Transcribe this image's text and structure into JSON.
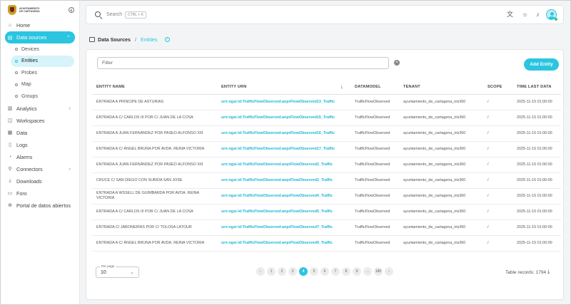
{
  "brand": {
    "line1": "AYUNTAMIENTO",
    "line2": "DE CARTAGENA"
  },
  "colors": {
    "accent": "#2cc5e0",
    "urn_text": "#1cb7d4"
  },
  "sidebar": {
    "items": [
      {
        "label": "Home",
        "icon": "home-icon"
      },
      {
        "label": "Data sources",
        "icon": "data-sources-icon",
        "active": true
      },
      {
        "label": "Analytics",
        "icon": "analytics-icon"
      },
      {
        "label": "Workspaces",
        "icon": "workspaces-icon"
      },
      {
        "label": "Data",
        "icon": "data-icon"
      },
      {
        "label": "Logs",
        "icon": "logs-icon"
      },
      {
        "label": "Alarms",
        "icon": "alarms-icon"
      },
      {
        "label": "Connectors",
        "icon": "connectors-icon"
      },
      {
        "label": "Downloads",
        "icon": "downloads-icon"
      },
      {
        "label": "Foro",
        "icon": "foro-icon"
      },
      {
        "label": "Portal de datos abiertos",
        "icon": "portal-icon"
      }
    ],
    "sub_items": [
      {
        "label": "Devices"
      },
      {
        "label": "Entities",
        "active": true
      },
      {
        "label": "Probes"
      },
      {
        "label": "Map"
      },
      {
        "label": "Groups"
      }
    ]
  },
  "topbar": {
    "search_label": "Search",
    "search_shortcut": "CTRL + K"
  },
  "breadcrumb": {
    "root": "Data Sources",
    "separator": "/",
    "current": "Entities"
  },
  "toolbar": {
    "filter_placeholder": "Filter",
    "add_label": "Add Entity"
  },
  "table": {
    "headers": [
      "ENTITY NAME",
      "ENTITY URN",
      "DATAMODEL",
      "TENANT",
      "SCOPE",
      "TIME LAST DATA"
    ],
    "rows": [
      [
        "ENTRADA A PRINCIPE DE ASTURIAS",
        "urn:ngsi-ld:TrafficFlowObserved:anprFlowObserved13_Traffic",
        "TrafficFlowObserved",
        "ayuntamiento_de_cartagena_iris360",
        "/",
        "2025-11-15 01:00:00"
      ],
      [
        "ENTRADA A C/ CARLOS III POR C/ JUAN DE LA COSA",
        "urn:ngsi-ld:TrafficFlowObserved:anprFlowObserved15_Traffic",
        "TrafficFlowObserved",
        "ayuntamiento_de_cartagena_iris360",
        "/",
        "2025-11-15 01:00:00"
      ],
      [
        "ENTRADA A JUAN FERNÁNDEZ POR PASEO ALFONSO XIII",
        "urn:ngsi-ld:TrafficFlowObserved:anprFlowObserved16_Traffic",
        "TrafficFlowObserved",
        "ayuntamiento_de_cartagena_iris360",
        "/",
        "2025-11-15 01:00:00"
      ],
      [
        "ENTRADA A C/ ÁNGEL BRUNA POR AVDA. REINA VICTORIA",
        "urn:ngsi-ld:TrafficFlowObserved:anprFlowObserved17_Traffic",
        "TrafficFlowObserved",
        "ayuntamiento_de_cartagena_iris360",
        "/",
        "2025-11-15 01:00:00"
      ],
      [
        "ENTRADA A JUAN FERNÁNDEZ POR PASEO ALFONSO XIII",
        "urn:ngsi-ld:TrafficFlowObserved:anprFlowObserved2_Traffic",
        "TrafficFlowObserved",
        "ayuntamiento_de_cartagena_iris360",
        "/",
        "2025-11-15 01:00:00"
      ],
      [
        "CRUCE C/ SAN DIEGO CON SUBIDA SAN JOSE",
        "urn:ngsi-ld:TrafficFlowObserved:anprFlowObserved3_Traffic",
        "TrafficFlowObserved",
        "ayuntamiento_de_cartagena_iris360",
        "/",
        "2025-11-15 01:00:00"
      ],
      [
        "ENTRADA A WSSELL DE GUIMBARDA POR AVDA. REINA VICTORIA",
        "urn:ngsi-ld:TrafficFlowObserved:anprFlowObserved4_Traffic",
        "TrafficFlowObserved",
        "ayuntamiento_de_cartagena_iris360",
        "/",
        "2025-11-15 01:00:00"
      ],
      [
        "ENTRADA A C/ CARLOS III POR C/ JUAN DE LA COSA",
        "urn:ngsi-ld:TrafficFlowObserved:anprFlowObserved5_Traffic",
        "TrafficFlowObserved",
        "ayuntamiento_de_cartagena_iris360",
        "/",
        "2025-11-15 01:00:00"
      ],
      [
        "ENTRADA C/ JABONERÍAS POR C/ TOLOSA LATOUR",
        "urn:ngsi-ld:TrafficFlowObserved:anprFlowObserved7_Traffic",
        "TrafficFlowObserved",
        "ayuntamiento_de_cartagena_iris360",
        "/",
        "2025-11-15 01:00:00"
      ],
      [
        "ENTRADA A C/ ÁNGEL BRUNA POR AVDA. REINA VICTORIA",
        "urn:ngsi-ld:TrafficFlowObserved:anprFlowObserved9_Traffic",
        "TrafficFlowObserved",
        "ayuntamiento_de_cartagena_iris360",
        "/",
        "2025-11-15 01:00:00"
      ]
    ]
  },
  "footer": {
    "per_page_label": "Per page",
    "per_page_value": "10",
    "pages": [
      "‹",
      "1",
      "2",
      "3",
      "4",
      "5",
      "6",
      "7",
      "8",
      "9",
      "...",
      "180",
      "›"
    ],
    "current_page": "4",
    "records_text": "Table records: 1794"
  }
}
